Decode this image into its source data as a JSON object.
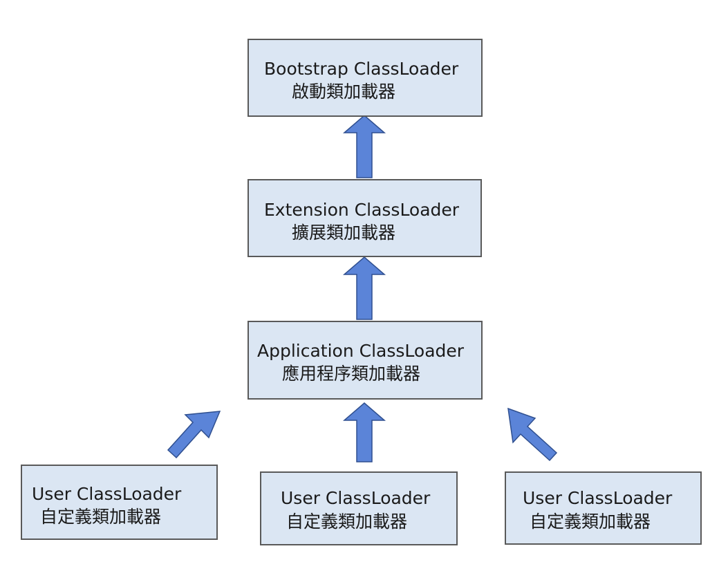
{
  "diagram": {
    "nodes": [
      {
        "id": "bootstrap",
        "title": "Bootstrap ClassLoader",
        "subtitle": "啟動類加載器"
      },
      {
        "id": "extension",
        "title": "Extension ClassLoader",
        "subtitle": "擴展類加載器"
      },
      {
        "id": "application",
        "title": "Application ClassLoader",
        "subtitle": "應用程序類加載器"
      },
      {
        "id": "user-left",
        "title": "User ClassLoader",
        "subtitle": "自定義類加載器"
      },
      {
        "id": "user-center",
        "title": "User ClassLoader",
        "subtitle": "自定義類加載器"
      },
      {
        "id": "user-right",
        "title": "User ClassLoader",
        "subtitle": "自定義類加載器"
      }
    ],
    "edges": [
      {
        "from": "extension",
        "to": "bootstrap"
      },
      {
        "from": "application",
        "to": "extension"
      },
      {
        "from": "user-left",
        "to": "application"
      },
      {
        "from": "user-center",
        "to": "application"
      },
      {
        "from": "user-right",
        "to": "application"
      }
    ],
    "colors": {
      "box_fill": "#dbe6f3",
      "box_border": "#595959",
      "arrow_fill": "#5b84d8",
      "arrow_stroke": "#2f4f8f",
      "text": "#1a1a1a"
    }
  }
}
